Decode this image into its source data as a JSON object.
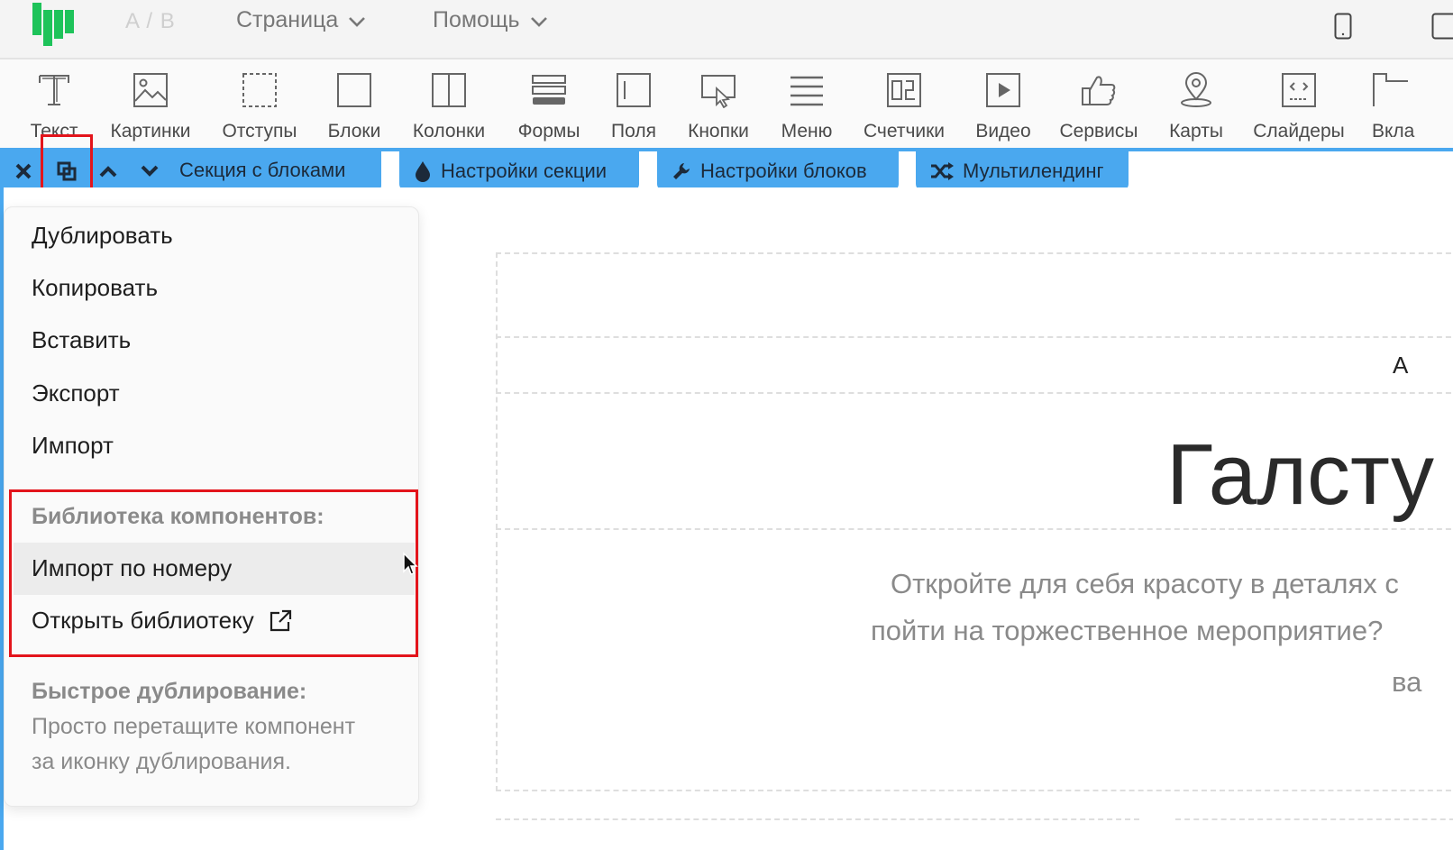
{
  "topbar": {
    "ab_label": "A / B",
    "menus": [
      {
        "label": "Страница"
      },
      {
        "label": "Помощь"
      }
    ]
  },
  "toolbar": {
    "tools": [
      {
        "label": "Текст",
        "icon": "text-icon"
      },
      {
        "label": "Картинки",
        "icon": "image-icon"
      },
      {
        "label": "Отступы",
        "icon": "spacing-icon"
      },
      {
        "label": "Блоки",
        "icon": "block-icon"
      },
      {
        "label": "Колонки",
        "icon": "columns-icon"
      },
      {
        "label": "Формы",
        "icon": "form-icon"
      },
      {
        "label": "Поля",
        "icon": "field-icon"
      },
      {
        "label": "Кнопки",
        "icon": "button-icon"
      },
      {
        "label": "Меню",
        "icon": "menu-icon"
      },
      {
        "label": "Счетчики",
        "icon": "counter-icon"
      },
      {
        "label": "Видео",
        "icon": "video-icon"
      },
      {
        "label": "Сервисы",
        "icon": "thumbs-up-icon"
      },
      {
        "label": "Карты",
        "icon": "map-pin-icon"
      },
      {
        "label": "Слайдеры",
        "icon": "slider-icon"
      },
      {
        "label": "Вкла",
        "icon": "tabs-icon"
      }
    ]
  },
  "editbar": {
    "section_title": "Секция с блоками",
    "section_settings": "Настройки секции",
    "block_settings": "Настройки блоков",
    "multilanding": "Мультилендинг"
  },
  "dropdown": {
    "items": [
      "Дублировать",
      "Копировать",
      "Вставить",
      "Экспорт",
      "Импорт"
    ],
    "library_header": "Библиотека компонентов:",
    "import_by_number": "Импорт по номеру",
    "open_library": "Открыть библиотеку",
    "quick_dup_header": "Быстрое дублирование:",
    "quick_dup_line1": "Просто перетащите компонент",
    "quick_dup_line2": "за иконку дублирования."
  },
  "canvas": {
    "letter": "А",
    "heading": "Галсту",
    "para_line1": "Откройте для себя красоту в деталях с",
    "para_line2": "пойти на торжественное мероприятие?",
    "para_line3": "ва"
  },
  "colors": {
    "accent_blue": "#4aa8ef",
    "highlight_red": "#e3141b",
    "logo_green": "#1ec35a"
  }
}
